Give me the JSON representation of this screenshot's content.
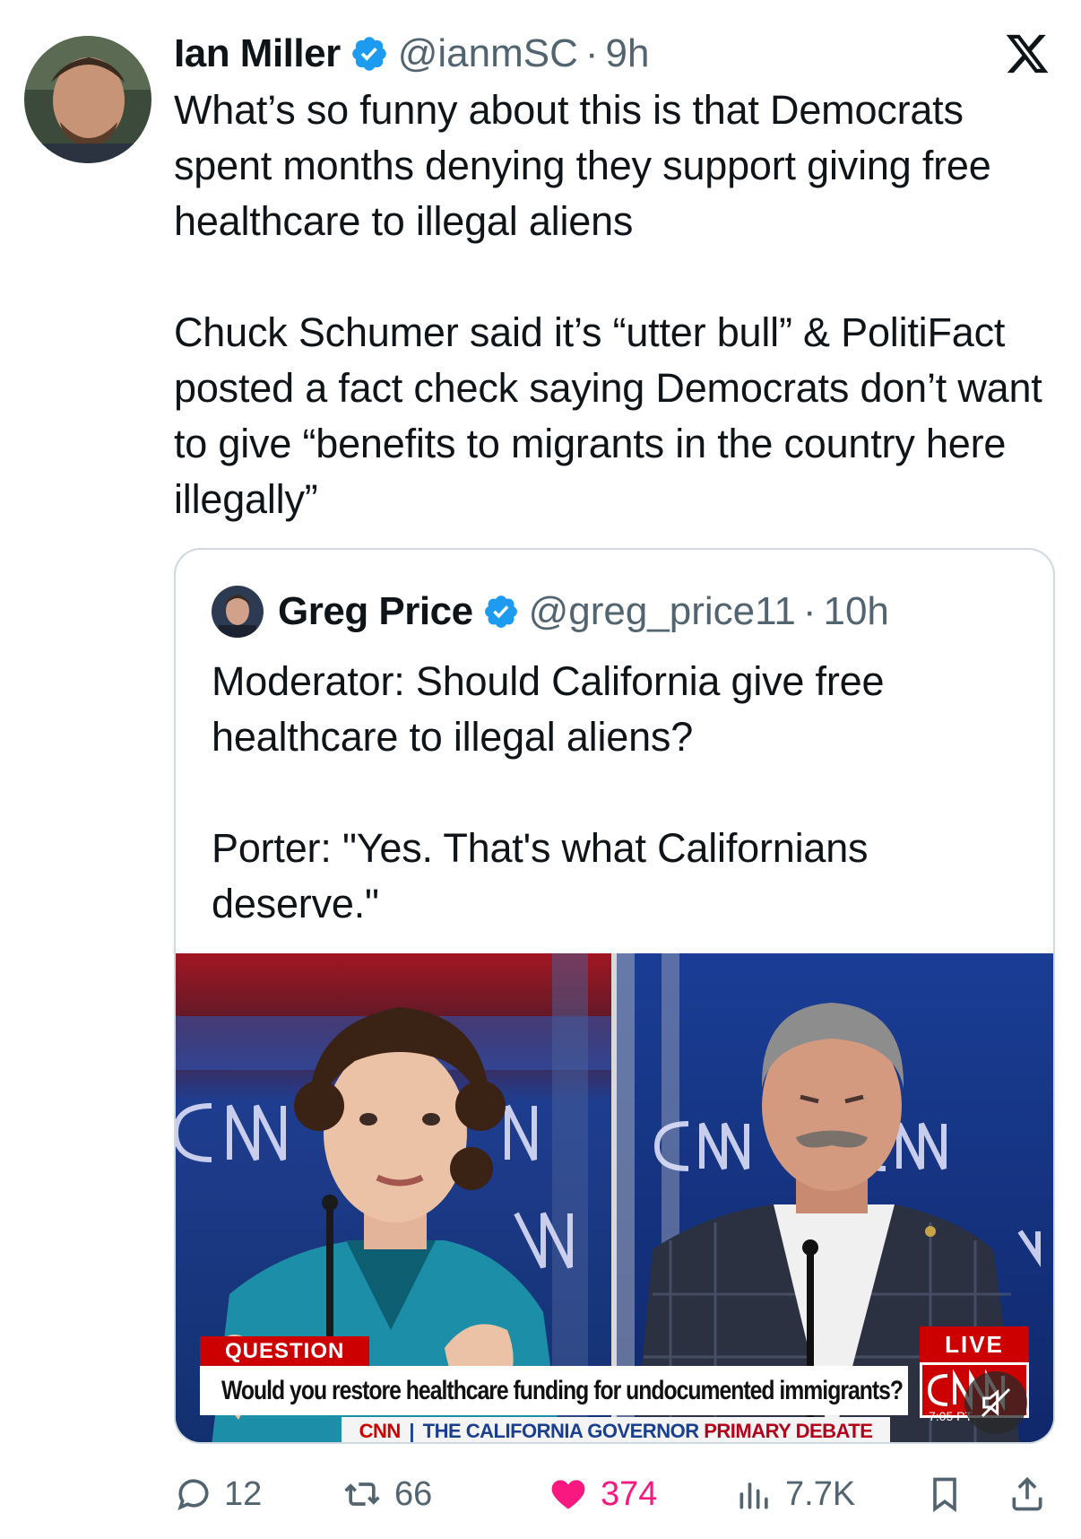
{
  "tweet": {
    "author_name": "Ian Miller",
    "handle": "@ianmSC",
    "dot": "·",
    "time": "9h",
    "text": "What’s so funny about this is that Democrats spent months denying they support giving free healthcare to illegal aliens\n\nChuck Schumer said it’s “utter bull” & PolitiFact posted a fact check saying Democrats don’t want to give “benefits to migrants in the country here illegally”"
  },
  "quoted_tweet": {
    "author_name": "Greg Price",
    "handle": "@greg_price11",
    "dot": "·",
    "time": "10h",
    "text": "Moderator: Should California give free healthcare to illegal aliens?\n\nPorter: \"Yes. That's what Californians deserve.\"",
    "media": {
      "question_tag": "QUESTION",
      "question": "Would you restore healthcare funding for undocumented immigrants?",
      "debate_network": "CNN",
      "debate_title_blue": "THE CALIFORNIA GOVERNOR",
      "debate_title_red": "PRIMARY DEBATE",
      "live_label": "LIVE",
      "clock": "7:05 PT",
      "backdrop_logo": "CNN"
    }
  },
  "actions": {
    "replies": "12",
    "reposts": "66",
    "likes": "374",
    "views": "7.7K"
  },
  "colors": {
    "verified": "#1d9bf0",
    "like": "#f91880",
    "muted_text": "#536471",
    "cnn_red": "#cc0000"
  },
  "icons": [
    "verified-badge-icon",
    "x-logo-icon",
    "reply-icon",
    "repost-icon",
    "heart-icon",
    "views-icon",
    "bookmark-icon",
    "share-icon",
    "mute-icon"
  ]
}
